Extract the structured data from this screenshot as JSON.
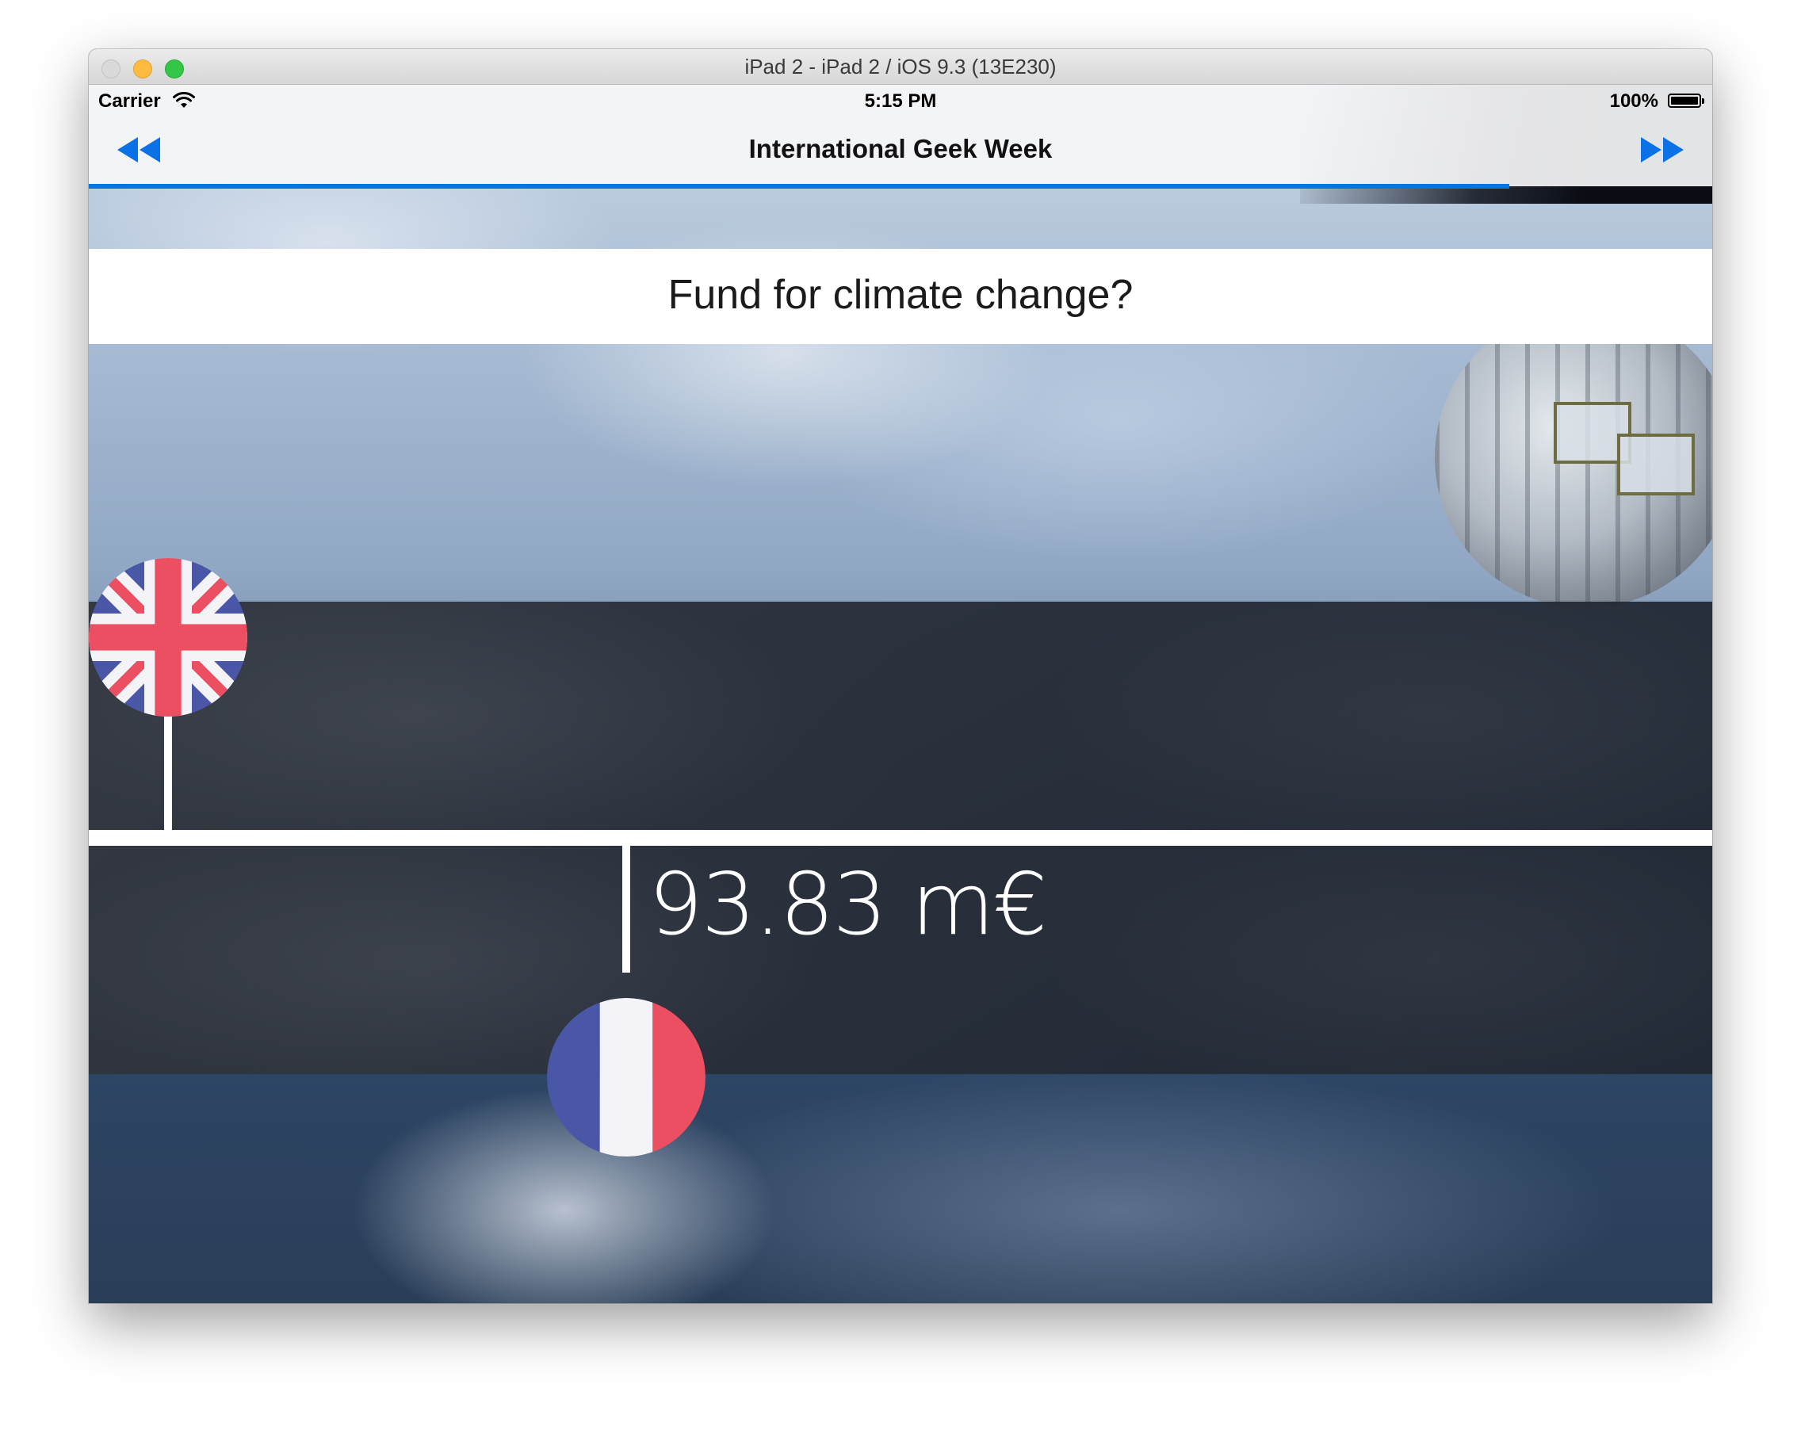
{
  "window": {
    "title": "iPad 2 - iPad 2 / iOS 9.3 (13E230)"
  },
  "status_bar": {
    "carrier": "Carrier",
    "time": "5:15 PM",
    "battery": "100%"
  },
  "nav": {
    "title": "International Geek Week",
    "prev_icon": "rewind-icon",
    "next_icon": "fast-forward-icon",
    "progress": 0.875,
    "accent": "#0a72e6"
  },
  "question": {
    "text": "Fund for climate change?"
  },
  "answer": {
    "value_label": "93.83 m€"
  },
  "flags": {
    "top": "united-kingdom-flag",
    "bottom": "france-flag"
  },
  "colors": {
    "flag_blue": "#4a56a6",
    "flag_red": "#ec4f62",
    "flag_white": "#f4f4f8"
  }
}
